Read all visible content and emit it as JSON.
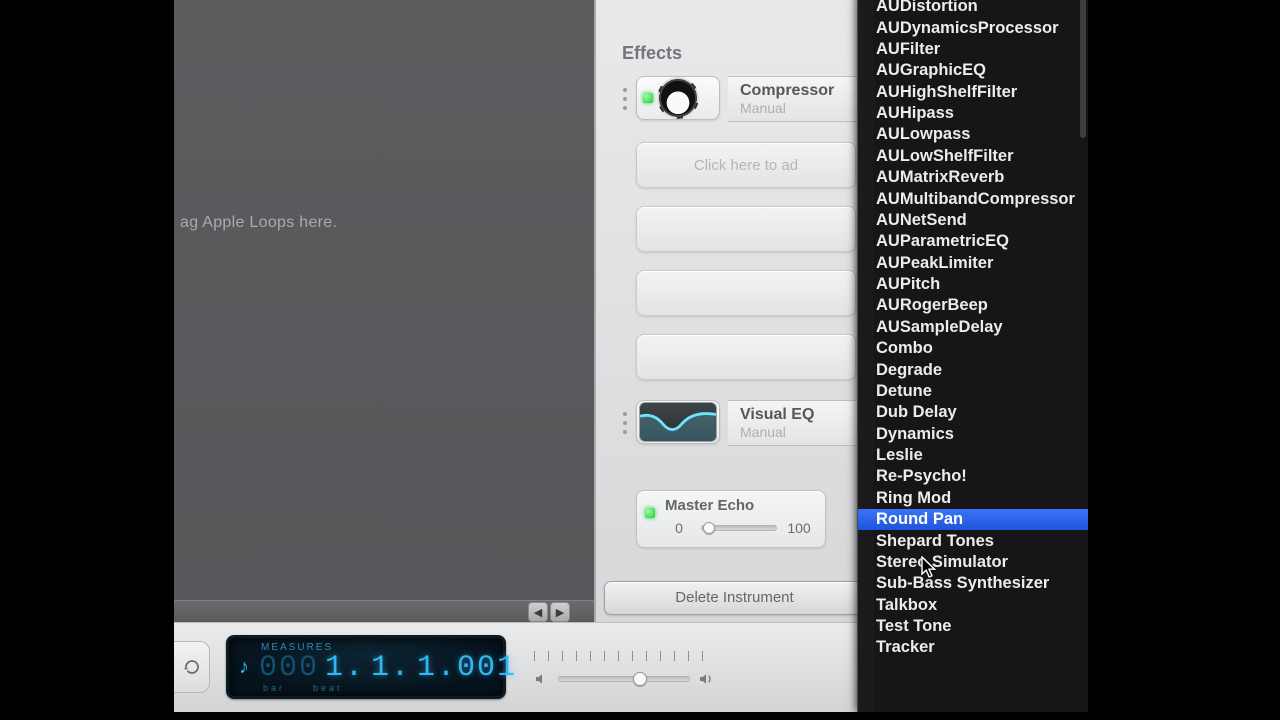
{
  "arrange": {
    "hint": "ag Apple Loops here."
  },
  "inspector": {
    "effects_label": "Effects",
    "compressor": {
      "name": "Compressor",
      "sub": "Manual"
    },
    "add_placeholder": "Click here to ad",
    "visual_eq": {
      "name": "Visual EQ",
      "sub": "Manual"
    },
    "echo": {
      "title": "Master Echo",
      "min": "0",
      "max": "100",
      "value_pct": 10
    },
    "delete_btn": "Delete Instrument"
  },
  "transport": {
    "lcd_label": "MEASURES",
    "lcd_bar_dim": "000",
    "lcd_bar": "1.",
    "lcd_beat": "1.",
    "lcd_sub": "1.001",
    "sub_bar": "bar",
    "sub_beat_label": "beat",
    "volume_pct": 62
  },
  "menu": {
    "items": [
      "AUDistortion",
      "AUDynamicsProcessor",
      "AUFilter",
      "AUGraphicEQ",
      "AUHighShelfFilter",
      "AUHipass",
      "AULowpass",
      "AULowShelfFilter",
      "AUMatrixReverb",
      "AUMultibandCompressor",
      "AUNetSend",
      "AUParametricEQ",
      "AUPeakLimiter",
      "AUPitch",
      "AURogerBeep",
      "AUSampleDelay",
      "Combo",
      "Degrade",
      "Detune",
      "Dub Delay",
      "Dynamics",
      "Leslie",
      "Re-Psycho!",
      "Ring Mod",
      "Round Pan",
      "Shepard Tones",
      "Stereo Simulator",
      "Sub-Bass Synthesizer",
      "Talkbox",
      "Test Tone",
      "Tracker"
    ],
    "selected_index": 24
  }
}
